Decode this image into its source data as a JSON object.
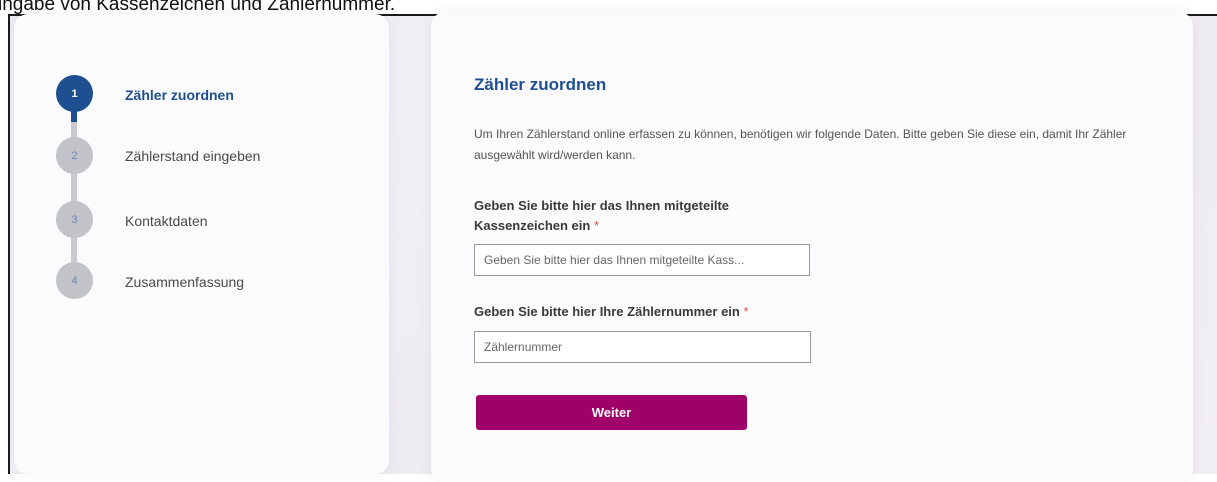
{
  "caption": "ingabe von Kassenzeichen und Zählernummer.",
  "steps": [
    {
      "number": "1",
      "label": "Zähler zuordnen",
      "active": true
    },
    {
      "number": "2",
      "label": "Zählerstand eingeben",
      "active": false
    },
    {
      "number": "3",
      "label": "Kontaktdaten",
      "active": false
    },
    {
      "number": "4",
      "label": "Zusammenfassung",
      "active": false
    }
  ],
  "form": {
    "title": "Zähler zuordnen",
    "intro": "Um Ihren Zählerstand online erfassen zu können, benötigen wir folgende Daten. Bitte geben Sie diese ein, damit Ihr Zähler ausgewählt wird/werden kann.",
    "kassenzeichen": {
      "label_line1": "Geben Sie bitte hier das Ihnen mitgeteilte",
      "label_line2": "Kassenzeichen ein",
      "required_mark": "*",
      "placeholder": "Geben Sie bitte hier das Ihnen mitgeteilte Kass...",
      "value": ""
    },
    "zaehlernummer": {
      "label": "Geben Sie bitte hier Ihre Zählernummer ein",
      "required_mark": "*",
      "placeholder": "Zählernummer",
      "value": ""
    },
    "submit_label": "Weiter"
  },
  "colors": {
    "primary": "#1d4f91",
    "accent": "#a0006a",
    "required": "#d9534f",
    "step_inactive": "#c2c2c9"
  }
}
